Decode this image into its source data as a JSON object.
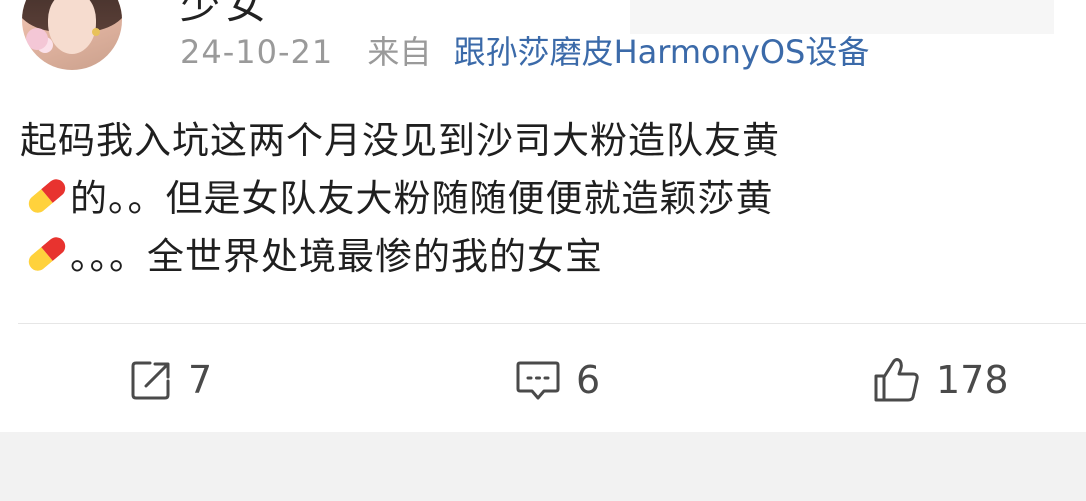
{
  "post": {
    "author_name_fragment": "少女",
    "date": "24-10-21",
    "from_label": "来自",
    "device": "跟孙莎磨皮HarmonyOS设备",
    "content": {
      "line1": "起码我入坑这两个月没见到沙司大粉造队友黄",
      "line2": "的。。但是女队友大粉随随便便就造颖莎黄",
      "line3": "。。。全世界处境最惨的我的女宝"
    },
    "emoji": "pill-emoji"
  },
  "actions": {
    "repost": {
      "icon": "share-icon",
      "count": "7"
    },
    "comment": {
      "icon": "comment-icon",
      "count": "6"
    },
    "like": {
      "icon": "thumbs-up-icon",
      "count": "178"
    }
  },
  "colors": {
    "link_blue": "#3b6aa9",
    "meta_gray": "#9a9a9a",
    "text": "#1f1f1f",
    "footer_bg": "#f2f2f2"
  }
}
